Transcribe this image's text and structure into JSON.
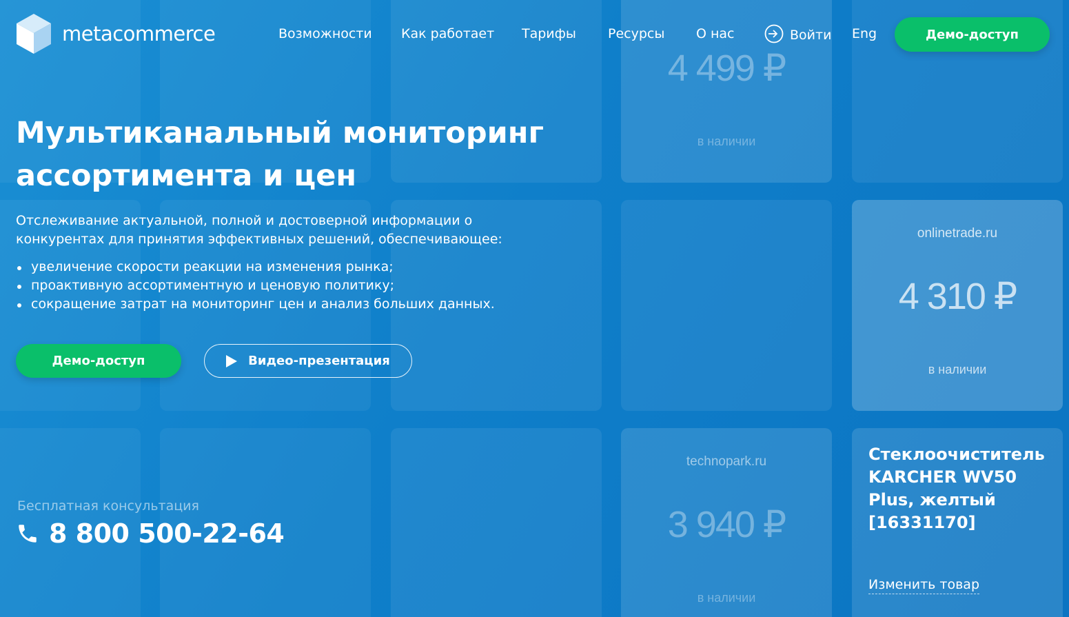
{
  "logo": {
    "text": "metacommerce"
  },
  "nav": {
    "items": [
      "Возможности",
      "Как работает",
      "Тарифы",
      "Ресурсы",
      "О нас"
    ],
    "login_label": "Войти",
    "lang_label": "Eng",
    "demo_label": "Демо-доступ"
  },
  "hero": {
    "title_line1": "Мультиканальный мониторинг",
    "title_line2": "ассортимента и цен",
    "description_line1": "Отслеживание актуальной, полной и достоверной информации о",
    "description_line2": "конкурентах для принятия эффективных решений, обеспечивающее:",
    "benefits": [
      "увеличение скорости реакции на изменения рынка;",
      "проактивную ассортиментную и ценовую политику;",
      "сокращение затрат на мониторинг цен и анализ больших данных."
    ],
    "demo_button": "Демо-доступ",
    "video_button": "Видео-презентация"
  },
  "consultation": {
    "label": "Бесплатная консультация",
    "phone": "8 800 500-22-64"
  },
  "cards": {
    "top": {
      "store": "",
      "price": "4 499 ₽",
      "stock": "в наличии"
    },
    "onlinetrade": {
      "store": "onlinetrade.ru",
      "price": "4 310 ₽",
      "stock": "в наличии"
    },
    "technopark": {
      "store": "technopark.ru",
      "price": "3 940 ₽",
      "stock": "в наличии"
    },
    "product": {
      "title": "Стеклоочиститель KARCHER WV50 Plus, желтый [16331170]",
      "change_link": "Изменить товар"
    }
  },
  "colors": {
    "accent_green": "#0abf6a",
    "background_blue": "#0f7fca"
  }
}
